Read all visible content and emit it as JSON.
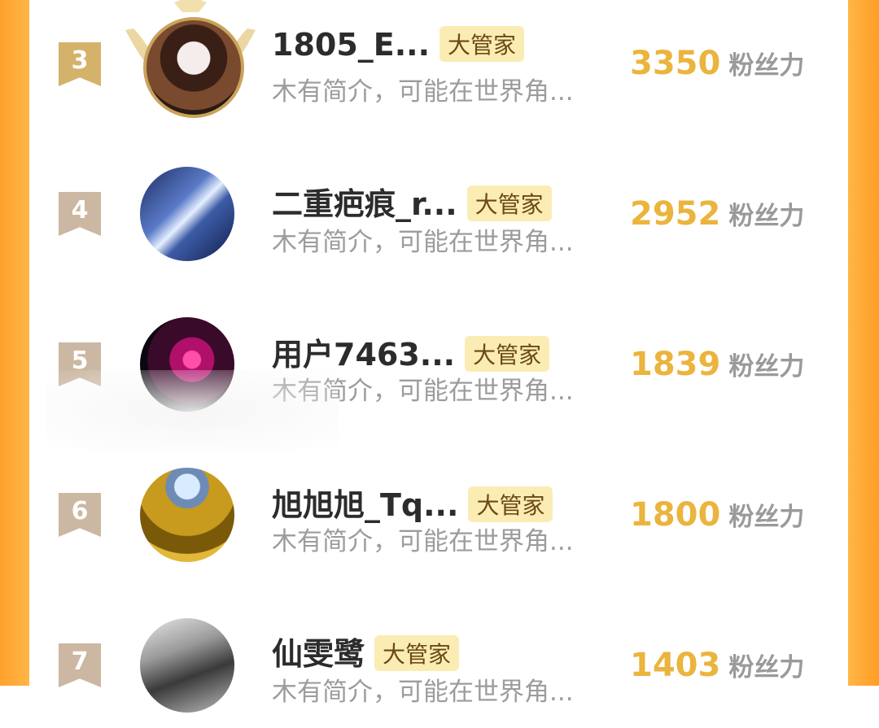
{
  "badge_label": "大管家",
  "unit_label": "粉丝力",
  "colors": {
    "frame_orange": "#ffa12e",
    "score_gold": "#ebb43d",
    "badge_bg": "#fbecb4",
    "rank_top": "#d4b26a",
    "rank_normal": "#cbb7a2"
  },
  "rows": [
    {
      "rank": "3",
      "name": "1805_E...",
      "badge": "大管家",
      "bio": "木有简介，可能在世界角...",
      "score": "3350",
      "unit": "粉丝力"
    },
    {
      "rank": "4",
      "name": "二重疤痕_r...",
      "badge": "大管家",
      "bio": "木有简介，可能在世界角...",
      "score": "2952",
      "unit": "粉丝力"
    },
    {
      "rank": "5",
      "name": "用户7463...",
      "badge": "大管家",
      "bio": "木有简介，可能在世界角...",
      "score": "1839",
      "unit": "粉丝力"
    },
    {
      "rank": "6",
      "name": "旭旭旭_Tq...",
      "badge": "大管家",
      "bio": "木有简介，可能在世界角...",
      "score": "1800",
      "unit": "粉丝力"
    },
    {
      "rank": "7",
      "name": "仙雯鹭",
      "badge": "大管家",
      "bio": "木有简介，可能在世界角...",
      "score": "1403",
      "unit": "粉丝力"
    }
  ]
}
